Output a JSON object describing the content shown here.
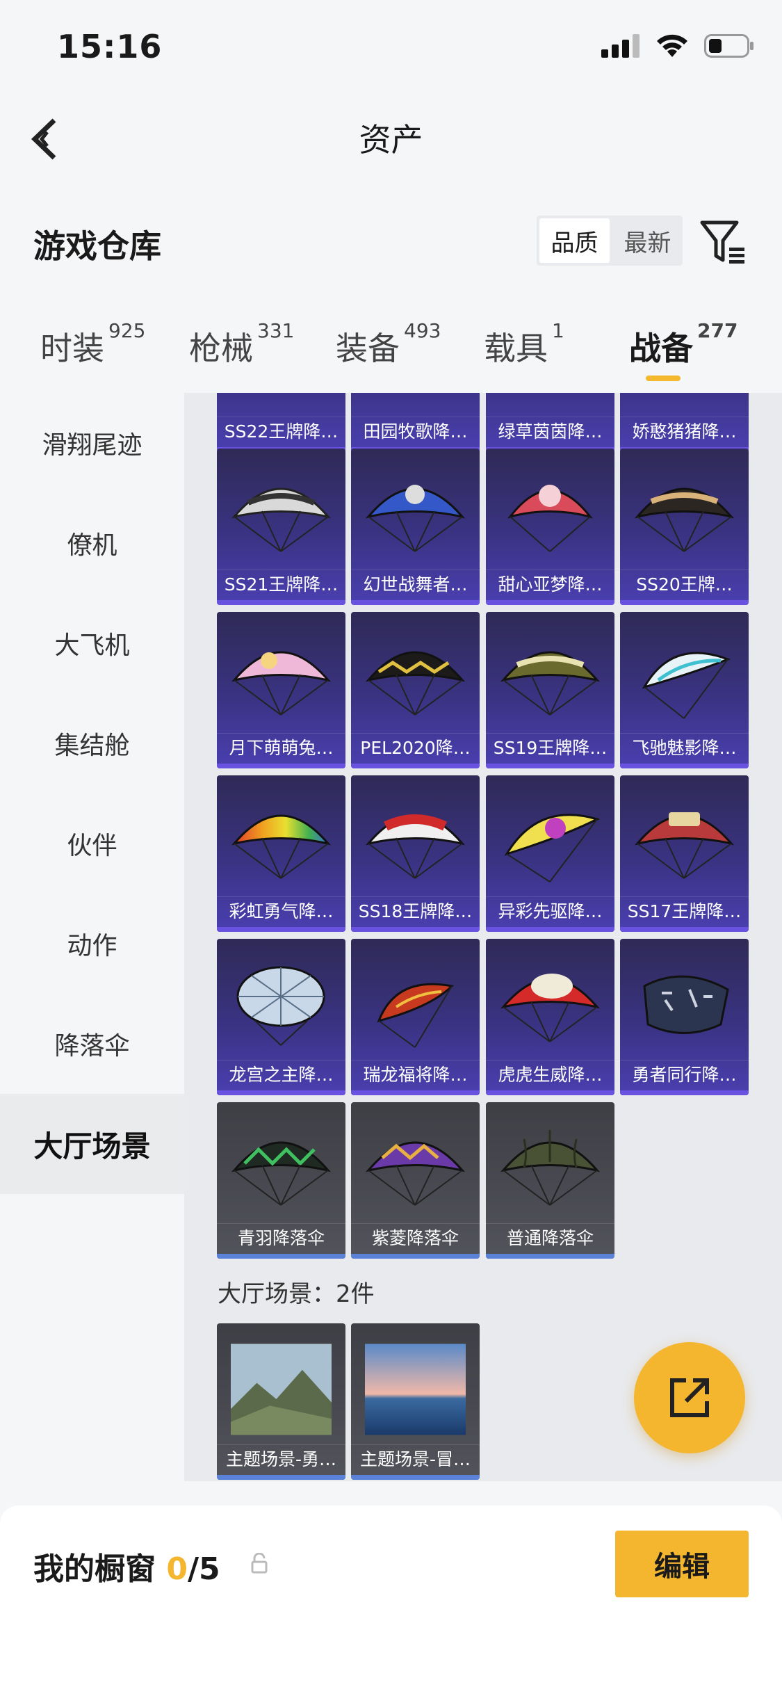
{
  "status": {
    "time": "15:16"
  },
  "nav": {
    "title": "资产"
  },
  "warehouse": {
    "title": "游戏仓库",
    "sort_quality": "品质",
    "sort_latest": "最新"
  },
  "tabs": [
    {
      "label": "时装",
      "count": "925"
    },
    {
      "label": "枪械",
      "count": "331"
    },
    {
      "label": "装备",
      "count": "493"
    },
    {
      "label": "载具",
      "count": "1"
    },
    {
      "label": "战备",
      "count": "277"
    }
  ],
  "sidebar": [
    "滑翔尾迹",
    "僚机",
    "大飞机",
    "集结舱",
    "伙伴",
    "动作",
    "降落伞",
    "大厅场景"
  ],
  "parachutes": [
    "SS22王牌降…",
    "田园牧歌降…",
    "绿草茵茵降…",
    "娇憨猪猪降…",
    "SS21王牌降…",
    "幻世战舞者…",
    "甜心亚梦降…",
    "SS20王牌…",
    "月下萌萌兔…",
    "PEL2020降…",
    "SS19王牌降…",
    "飞驰魅影降…",
    "彩虹勇气降…",
    "SS18王牌降…",
    "异彩先驱降…",
    "SS17王牌降…",
    "龙宫之主降…",
    "瑞龙福将降…",
    "虎虎生威降…",
    "勇者同行降…",
    "青羽降落伞",
    "紫菱降落伞",
    "普通降落伞"
  ],
  "lobby": {
    "header": "大厅场景：2件",
    "items": [
      "主题场景-勇…",
      "主题场景-冒…"
    ]
  },
  "showcase": {
    "title": "我的橱窗",
    "count": "0",
    "total": "/5",
    "edit_label": "编辑"
  },
  "colors": {
    "accent": "#f4b52f",
    "card_purple": "#3a3383",
    "card_gray": "#52535b"
  }
}
